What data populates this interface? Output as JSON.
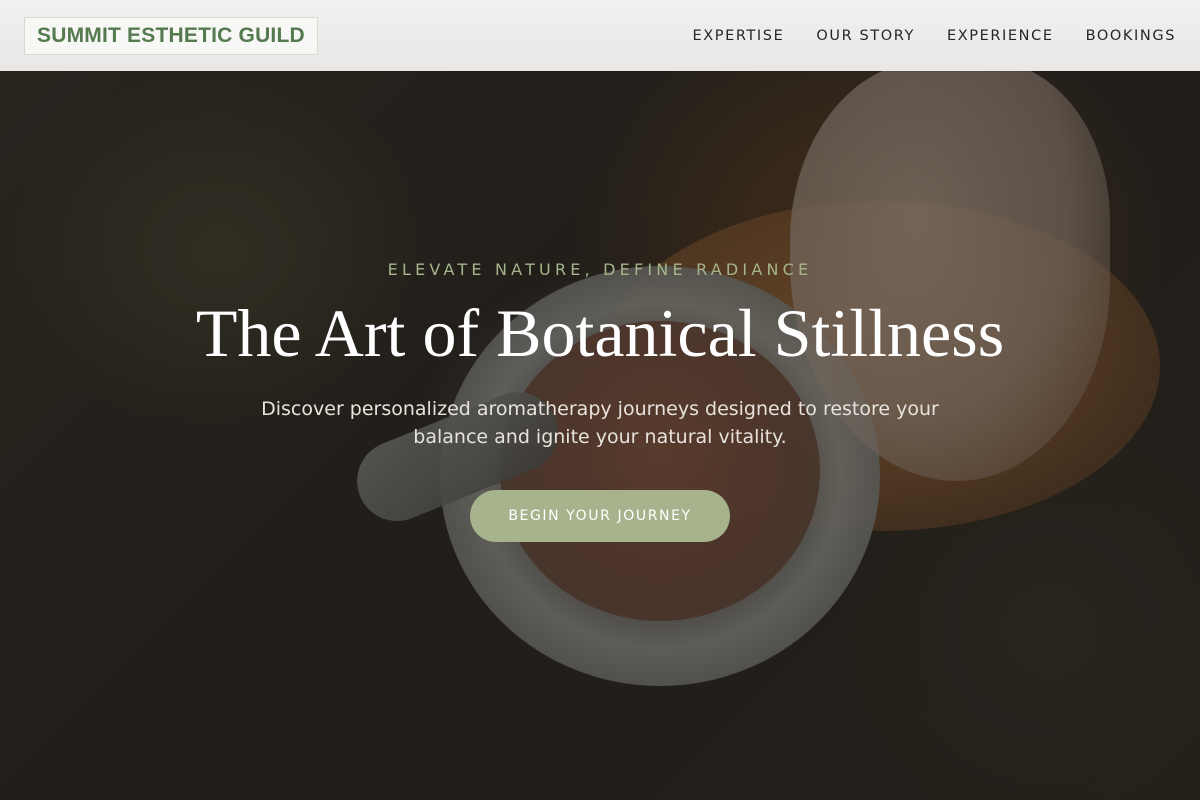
{
  "brand": {
    "name": "SUMMIT ESTHETIC GUILD"
  },
  "nav": {
    "items": [
      {
        "label": "EXPERTISE"
      },
      {
        "label": "OUR STORY"
      },
      {
        "label": "EXPERIENCE"
      },
      {
        "label": "BOOKINGS"
      }
    ]
  },
  "hero": {
    "eyebrow": "ELEVATE NATURE, DEFINE RADIANCE",
    "title": "The Art of Botanical Stillness",
    "subtitle": "Discover personalized aromatherapy journeys designed to restore your balance and ignite your natural vitality.",
    "cta_label": "BEGIN YOUR JOURNEY"
  },
  "colors": {
    "brand_green": "#557a4f",
    "eyebrow_green": "#a5b48b",
    "cta_bg": "#a7b38c",
    "header_bg": "#efeeec"
  }
}
